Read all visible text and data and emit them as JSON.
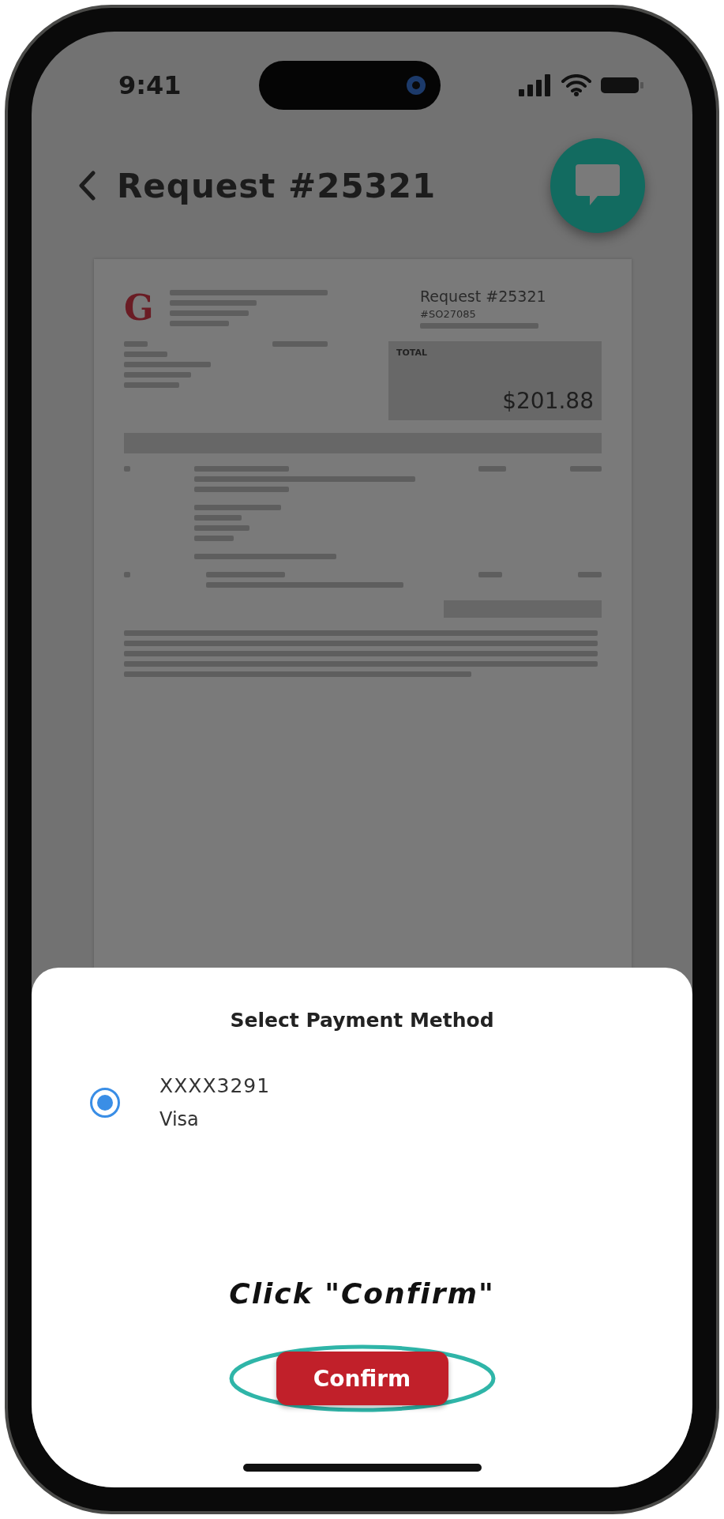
{
  "status_bar": {
    "time": "9:41"
  },
  "header": {
    "title": "Request #25321"
  },
  "document": {
    "logo": "G",
    "title": "Request #25321",
    "number": "#SO27085",
    "total_label": "TOTAL",
    "total": "$201.88"
  },
  "sheet": {
    "title": "Select Payment Method",
    "methods": [
      {
        "number": "XXXX3291",
        "brand": "Visa",
        "selected": true
      }
    ],
    "confirm": "Confirm"
  },
  "annotation": {
    "text": "Click \"Confirm\""
  }
}
